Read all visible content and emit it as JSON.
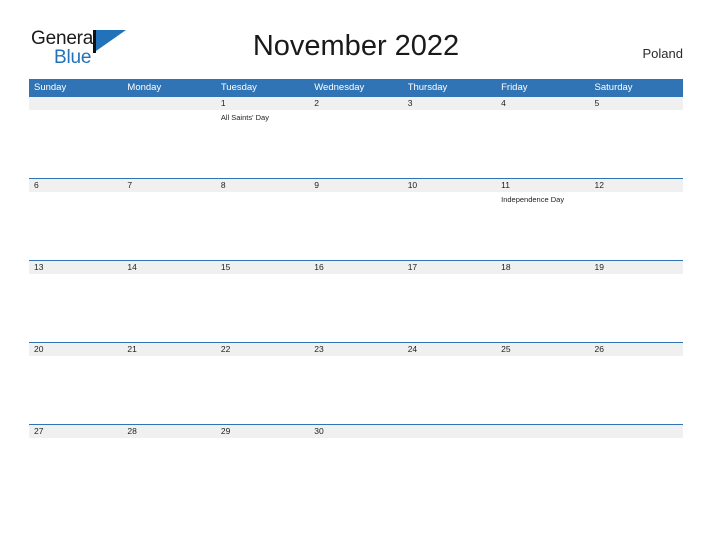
{
  "brand": {
    "name_part1": "General",
    "name_part2": "Blue",
    "flag_icon": "flag-icon",
    "accent_color": "#2272b9"
  },
  "header": {
    "title": "November 2022",
    "country": "Poland"
  },
  "calendar": {
    "header_bg_color": "#3174b5",
    "date_band_color": "#f0f0f0",
    "weekdays": [
      "Sunday",
      "Monday",
      "Tuesday",
      "Wednesday",
      "Thursday",
      "Friday",
      "Saturday"
    ],
    "weeks": [
      [
        {
          "day": "",
          "event": ""
        },
        {
          "day": "",
          "event": ""
        },
        {
          "day": "1",
          "event": "All Saints' Day"
        },
        {
          "day": "2",
          "event": ""
        },
        {
          "day": "3",
          "event": ""
        },
        {
          "day": "4",
          "event": ""
        },
        {
          "day": "5",
          "event": ""
        }
      ],
      [
        {
          "day": "6",
          "event": ""
        },
        {
          "day": "7",
          "event": ""
        },
        {
          "day": "8",
          "event": ""
        },
        {
          "day": "9",
          "event": ""
        },
        {
          "day": "10",
          "event": ""
        },
        {
          "day": "11",
          "event": "Independence Day"
        },
        {
          "day": "12",
          "event": ""
        }
      ],
      [
        {
          "day": "13",
          "event": ""
        },
        {
          "day": "14",
          "event": ""
        },
        {
          "day": "15",
          "event": ""
        },
        {
          "day": "16",
          "event": ""
        },
        {
          "day": "17",
          "event": ""
        },
        {
          "day": "18",
          "event": ""
        },
        {
          "day": "19",
          "event": ""
        }
      ],
      [
        {
          "day": "20",
          "event": ""
        },
        {
          "day": "21",
          "event": ""
        },
        {
          "day": "22",
          "event": ""
        },
        {
          "day": "23",
          "event": ""
        },
        {
          "day": "24",
          "event": ""
        },
        {
          "day": "25",
          "event": ""
        },
        {
          "day": "26",
          "event": ""
        }
      ],
      [
        {
          "day": "27",
          "event": ""
        },
        {
          "day": "28",
          "event": ""
        },
        {
          "day": "29",
          "event": ""
        },
        {
          "day": "30",
          "event": ""
        },
        {
          "day": "",
          "event": ""
        },
        {
          "day": "",
          "event": ""
        },
        {
          "day": "",
          "event": ""
        }
      ]
    ]
  }
}
